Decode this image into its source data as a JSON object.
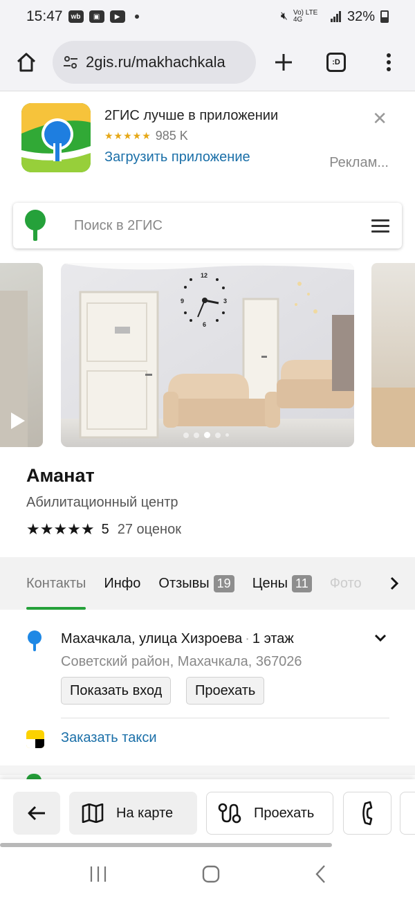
{
  "status_bar": {
    "time": "15:47",
    "app_badge": "wb",
    "signal_text": "Vo) LTE 4G",
    "battery": "32%"
  },
  "browser": {
    "url": "2gis.ru/makhachkala",
    "tabs_label": ":D"
  },
  "ad": {
    "title": "2ГИС лучше в приложении",
    "rating_stars": "★★★★★",
    "rating_count": "985 K",
    "link": "Загрузить приложение",
    "label": "Реклам...",
    "close": "✕"
  },
  "search": {
    "placeholder": "Поиск в 2ГИС"
  },
  "gallery": {
    "clock_number": "12"
  },
  "place": {
    "title": "Аманат",
    "category": "Абилитационный центр",
    "stars": "★★★★★",
    "score": "5",
    "reviews": "27 оценок"
  },
  "tabs": [
    {
      "label": "Контакты",
      "active": true
    },
    {
      "label": "Инфо"
    },
    {
      "label": "Отзывы",
      "badge": "19"
    },
    {
      "label": "Цены",
      "badge": "11"
    },
    {
      "label": "Фото"
    }
  ],
  "address": {
    "main": "Махачкала, улица Хизроева",
    "floor": "1 этаж",
    "sub": "Советский район, Махачкала, 367026",
    "show_entrance": "Показать вход",
    "route": "Проехать"
  },
  "taxi": {
    "label": "Заказать такси"
  },
  "actions": {
    "map": "На карте",
    "route": "Проехать"
  },
  "colors": {
    "brand_green": "#25a13a",
    "link_blue": "#1a6fa8",
    "pin_blue": "#1e88e5"
  }
}
